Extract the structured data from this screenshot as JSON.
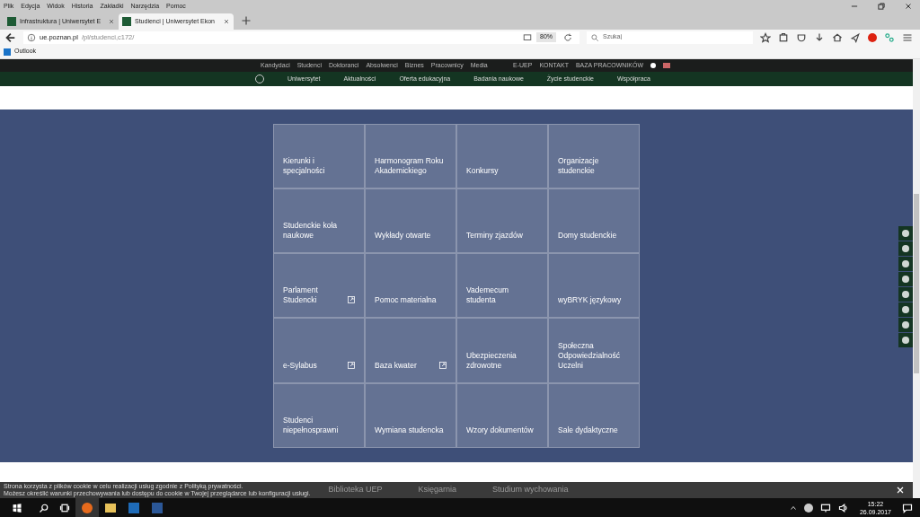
{
  "menu_bar": [
    "Plik",
    "Edycja",
    "Widok",
    "Historia",
    "Zakładki",
    "Narzędzia",
    "Pomoc"
  ],
  "tabs": [
    {
      "label": "Infrastruktura | Uniwersytet E",
      "selected": false
    },
    {
      "label": "Studienci | Uniwersytet Ekon",
      "selected": true
    }
  ],
  "address_bar": {
    "host": "ue.poznan.pl",
    "path": "/pl/studenci,c172/",
    "zoom": "80%",
    "search_placeholder": "Szukaj"
  },
  "bookmarks": [
    "Outlook"
  ],
  "site": {
    "top_links": [
      "Kandydaci",
      "Studenci",
      "Doktoranci",
      "Absolwenci",
      "Biznes",
      "Pracownicy",
      "Media"
    ],
    "top_right_links": [
      "E-UEP",
      "KONTAKT",
      "BAZA PRACOWNIKÓW"
    ],
    "nav": [
      "Uniwersytet",
      "Aktualności",
      "Oferta edukacyjna",
      "Badania naukowe",
      "Życie studenckie",
      "Współpraca"
    ],
    "tiles": [
      {
        "label": "Kierunki i specjalności",
        "external": false
      },
      {
        "label": "Harmonogram Roku Akademickiego",
        "external": false
      },
      {
        "label": "Konkursy",
        "external": false
      },
      {
        "label": "Organizacje studenckie",
        "external": false
      },
      {
        "label": "Studenckie koła naukowe",
        "external": false
      },
      {
        "label": "Wykłady otwarte",
        "external": false
      },
      {
        "label": "Terminy zjazdów",
        "external": false
      },
      {
        "label": "Domy studenckie",
        "external": false
      },
      {
        "label": "Parlament Studencki",
        "external": true
      },
      {
        "label": "Pomoc materialna",
        "external": false
      },
      {
        "label": "Vademecum studenta",
        "external": false
      },
      {
        "label": "wyBRYK językowy",
        "external": false
      },
      {
        "label": "e-Sylabus",
        "external": true
      },
      {
        "label": "Baza kwater",
        "external": true
      },
      {
        "label": "Ubezpieczenia zdrowotne",
        "external": false
      },
      {
        "label": "Społeczna Odpowiedzialność Uczelni",
        "external": false
      },
      {
        "label": "Studenci niepełnosprawni",
        "external": false
      },
      {
        "label": "Wymiana studencka",
        "external": false
      },
      {
        "label": "Wzory dokumentów",
        "external": false
      },
      {
        "label": "Sale dydaktyczne",
        "external": false
      }
    ],
    "bottom_links": [
      "Biblioteka UEP",
      "Księgarnia",
      "Studium wychowania"
    ],
    "cookie_notice": [
      "Strona korzysta z plików cookie w celu realizacji usług zgodnie z Polityką prywatności.",
      "Możesz określić warunki przechowywania lub dostępu do cookie w Twojej przeglądarce lub konfiguracji usługi."
    ]
  },
  "taskbar": {
    "time": "15:22",
    "date": "26.09.2017"
  }
}
